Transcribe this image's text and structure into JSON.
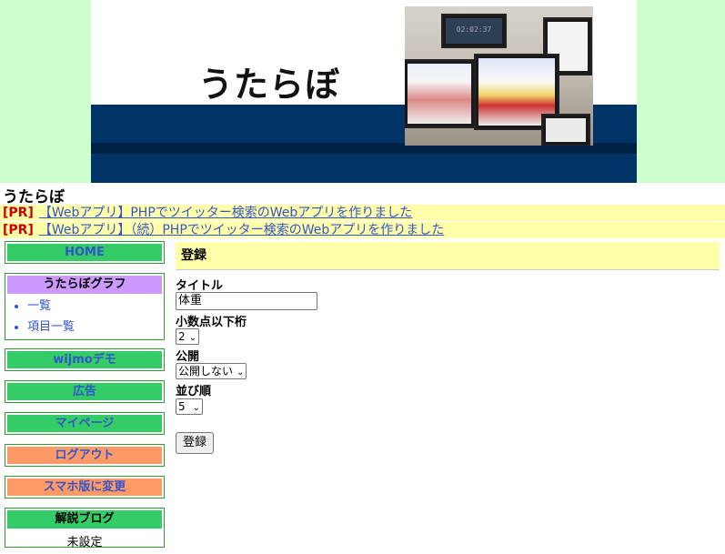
{
  "banner": {
    "logo_text": "うたらぼ",
    "photo_clock": "02:02:37"
  },
  "site_title": "うたらぼ",
  "pr": [
    {
      "tag": "[PR]",
      "link": "【Webアプリ】PHPでツイッター検索のWebアプリを作りました"
    },
    {
      "tag": "[PR]",
      "link": "【Webアプリ】（続）PHPでツイッター検索のWebアプリを作りました"
    }
  ],
  "sidebar": {
    "home": "HOME",
    "graph_box": {
      "title": "うたらぼグラフ",
      "items": [
        "一覧",
        "項目一覧"
      ]
    },
    "wijmo": "wijmoデモ",
    "ad": "広告",
    "mypage": "マイページ",
    "logout": "ログアウト",
    "mobile": "スマホ版に変更",
    "blog_box": {
      "title": "解説ブログ",
      "value": "未設定"
    }
  },
  "form": {
    "heading": "登録",
    "title_label": "タイトル",
    "title_value": "体重",
    "decimals_label": "小数点以下桁",
    "decimals_value": "2",
    "public_label": "公開",
    "public_value": "公開しない",
    "order_label": "並び順",
    "order_value": "5",
    "submit_label": "登録"
  },
  "colors": {
    "banner_bg": "#ccffcc",
    "pr_bg": "#ffffaa",
    "menu_green": "#33cc66",
    "menu_orange": "#ff9966",
    "box_header_purple": "#cc99ff",
    "link_blue": "#3355cc"
  }
}
